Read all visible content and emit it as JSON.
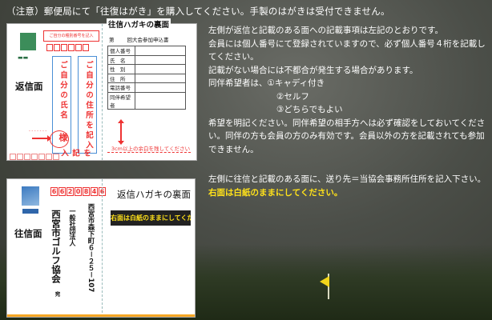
{
  "notice": "（注意）郵便局にて「往復はがき」を購入してください。手製のはがきは受付できません。",
  "top_card": {
    "side_label": "返信面",
    "back_title": "往信ハガキの裏面",
    "reg_header": "ご自分の種別番号を記入",
    "own_address": "ご自分の住所を記入",
    "own_name": "ご自分の氏名",
    "sama": "様",
    "kinyu": "を記入",
    "entry_heading_num": "第",
    "entry_heading": "回大会参加申込書",
    "form_rows": [
      "個人番号",
      "氏　名",
      "性　別",
      "住　所",
      "電話番号",
      "同伴希望者"
    ],
    "space_note": "3cm以上の余白を残してください"
  },
  "bottom_card": {
    "side_label": "往信面",
    "postal": [
      "6",
      "6",
      "2",
      "0",
      "8",
      "4",
      "6"
    ],
    "addr_line1": "西宮市森下町６－２５－107",
    "addr_line2": "一般社団法人",
    "addr_line3": "西宮市ゴルフ協会",
    "addr_suffix": "宛",
    "back_title": "返信ハガキの裏面",
    "banner": "右面は白紙のままにしてください。"
  },
  "para1": [
    "左側が返信と記載のある面への記載事項は左記のとおりです。",
    "会員には個人番号にて登録されていますので、必ず個人番号４桁を記載し",
    "てください。",
    "記載がない場合には不都合が発生する場合があります。",
    "同伴希望者は、①キャディ付き",
    "②セルフ",
    "③どちらでもよい",
    "希望を明記ください。同伴希望の相手方へは必ず確認をしておいてくださ",
    "い。同伴の方も会員の方のみ有効です。会員以外の方を記載されても参加",
    "できません。"
  ],
  "para2": {
    "line1": "左側に往信と記載のある面に、送り先＝当協会事務所住所を記入下さい。",
    "line2": "右面は白紙のままにしてください。"
  },
  "colors": {
    "accent_red": "#e33333",
    "highlight_yellow": "#ffe11a",
    "frame_blue": "#4a8fd6"
  }
}
